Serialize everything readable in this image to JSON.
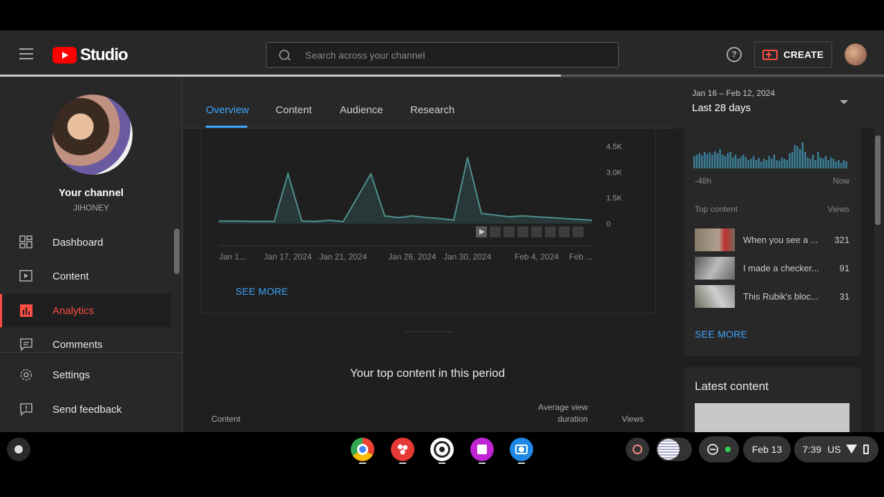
{
  "header": {
    "logo_text": "Studio",
    "search_placeholder": "Search across your channel",
    "help_symbol": "?",
    "create_label": "CREATE",
    "progress": 0.634
  },
  "sidebar": {
    "channel_title": "Your channel",
    "channel_name": "JIHONEY",
    "items": [
      {
        "label": "Dashboard",
        "icon": "dashboard-icon"
      },
      {
        "label": "Content",
        "icon": "content-icon"
      },
      {
        "label": "Analytics",
        "icon": "analytics-icon",
        "active": true
      },
      {
        "label": "Comments",
        "icon": "comments-icon"
      },
      {
        "label": "Settings",
        "icon": "gear-icon"
      },
      {
        "label": "Send feedback",
        "icon": "feedback-icon"
      }
    ]
  },
  "tabs": [
    "Overview",
    "Content",
    "Audience",
    "Research"
  ],
  "date_range": {
    "sub": "Jan 16 – Feb 12, 2024",
    "main": "Last 28 days"
  },
  "chart_data": {
    "type": "area",
    "x": [
      "Jan 16",
      "Jan 17",
      "Jan 18",
      "Jan 19",
      "Jan 20",
      "Jan 21",
      "Jan 22",
      "Jan 23",
      "Jan 24",
      "Jan 25",
      "Jan 26",
      "Jan 27",
      "Jan 28",
      "Jan 29",
      "Jan 30",
      "Jan 31",
      "Feb 1",
      "Feb 2",
      "Feb 3",
      "Feb 4",
      "Feb 5",
      "Feb 6",
      "Feb 7",
      "Feb 8",
      "Feb 9",
      "Feb 10",
      "Feb 11",
      "Feb 12"
    ],
    "series": [
      {
        "values": [
          150,
          150,
          140,
          130,
          130,
          2900,
          150,
          130,
          200,
          120,
          1500,
          2900,
          450,
          350,
          450,
          350,
          300,
          200,
          3850,
          600,
          500,
          400,
          450,
          400,
          350,
          300,
          250,
          200
        ]
      }
    ],
    "yticks": [
      "4.5K",
      "3.0K",
      "1.5K",
      "0"
    ],
    "ylim": [
      0,
      4500
    ],
    "xtick_labels": [
      "Jan 1...",
      "Jan 17, 2024",
      "Jan 21, 2024",
      "Jan 26, 2024",
      "Jan 30, 2024",
      "Feb 4, 2024",
      "Feb ..."
    ],
    "grid": false,
    "see_more": "SEE MORE"
  },
  "main": {
    "top_content_title": "Your top content in this period",
    "col_content": "Content",
    "col_avd": "Average view duration",
    "col_views": "Views"
  },
  "realtime": {
    "bars": [
      0.45,
      0.5,
      0.55,
      0.48,
      0.6,
      0.52,
      0.58,
      0.5,
      0.62,
      0.55,
      0.7,
      0.5,
      0.45,
      0.55,
      0.6,
      0.4,
      0.5,
      0.35,
      0.42,
      0.5,
      0.4,
      0.3,
      0.35,
      0.45,
      0.3,
      0.38,
      0.25,
      0.35,
      0.3,
      0.45,
      0.35,
      0.5,
      0.3,
      0.28,
      0.4,
      0.35,
      0.3,
      0.55,
      0.6,
      0.85,
      0.8,
      0.7,
      0.95,
      0.6,
      0.4,
      0.35,
      0.5,
      0.3,
      0.6,
      0.4,
      0.35,
      0.45,
      0.3,
      0.4,
      0.35,
      0.25,
      0.3,
      0.2,
      0.3,
      0.25
    ],
    "left_label": "-48h",
    "right_label": "Now",
    "top_content_label": "Top content",
    "views_label": "Views",
    "rows": [
      {
        "title": "When you see a ...",
        "views": "321"
      },
      {
        "title": "I made a checker...",
        "views": "91"
      },
      {
        "title": "This Rubik's bloc...",
        "views": "31"
      }
    ],
    "see_more": "SEE MORE"
  },
  "latest": {
    "title": "Latest content"
  },
  "taskbar": {
    "apps": [
      {
        "name": "chrome-icon",
        "color": "#4285f4"
      },
      {
        "name": "paint-icon",
        "color": "#e53935"
      },
      {
        "name": "camera-lens-icon",
        "color": "#ffffff"
      },
      {
        "name": "screencast-icon",
        "color": "#c026d3"
      },
      {
        "name": "photos-camera-icon",
        "color": "#1e88e5"
      }
    ],
    "date": "Feb 13",
    "time": "7:39",
    "locale": "US"
  }
}
